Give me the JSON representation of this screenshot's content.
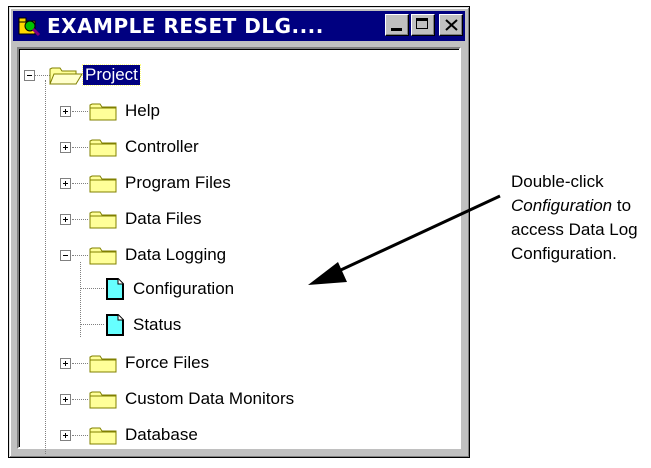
{
  "window": {
    "title": "EXAMPLE RESET DLG....",
    "buttons": [
      "minimize",
      "maximize",
      "close"
    ]
  },
  "tree": {
    "root": {
      "label": "Project",
      "icon": "open-folder-icon",
      "expanded": true,
      "selected": true
    },
    "items": [
      {
        "label": "Help",
        "icon": "folder-icon",
        "expanded": false
      },
      {
        "label": "Controller",
        "icon": "folder-icon",
        "expanded": false
      },
      {
        "label": "Program Files",
        "icon": "folder-icon",
        "expanded": false
      },
      {
        "label": "Data Files",
        "icon": "folder-icon",
        "expanded": false
      },
      {
        "label": "Data Logging",
        "icon": "folder-icon",
        "expanded": true,
        "children": [
          {
            "label": "Configuration",
            "icon": "document-icon"
          },
          {
            "label": "Status",
            "icon": "document-icon"
          }
        ]
      },
      {
        "label": "Force Files",
        "icon": "folder-icon",
        "expanded": false
      },
      {
        "label": "Custom Data Monitors",
        "icon": "folder-icon",
        "expanded": false
      },
      {
        "label": "Database",
        "icon": "folder-icon",
        "expanded": false
      }
    ]
  },
  "annotation": {
    "line1": "Double-click",
    "line2_italic": "Configuration",
    "line2_rest": " to",
    "line3": "access Data Log",
    "line4": "Configuration."
  },
  "colors": {
    "titlebar": "#000080",
    "folder": "#ffff99",
    "document": "#66ffff",
    "window_face": "#c0c0c0"
  }
}
